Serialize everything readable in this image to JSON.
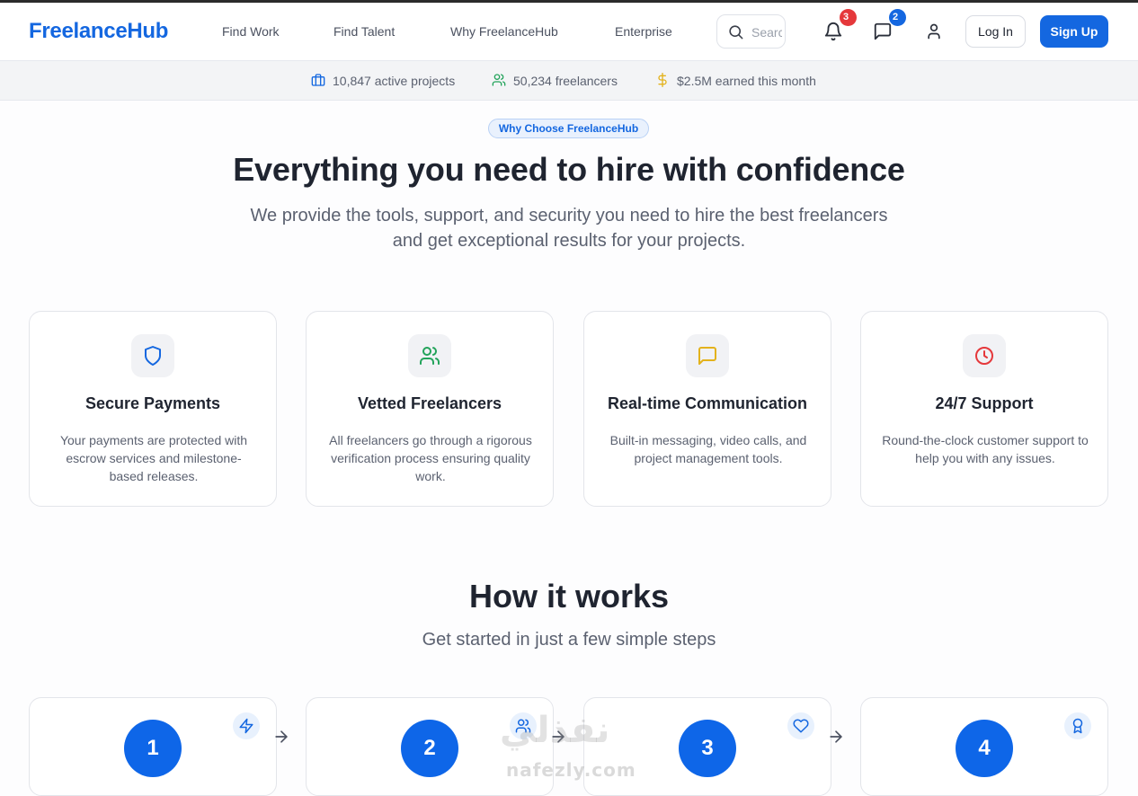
{
  "brand": {
    "name": "FreelanceHub",
    "primary_color": "#1467e0"
  },
  "nav": {
    "links": [
      "Find Work",
      "Find Talent",
      "Why FreelanceHub",
      "Enterprise"
    ],
    "search_placeholder": "Search",
    "notifications_count": "3",
    "messages_count": "2",
    "login_label": "Log In",
    "signup_label": "Sign Up",
    "icons": [
      "search-icon",
      "bell-icon",
      "message-icon",
      "user-icon"
    ]
  },
  "stats": [
    {
      "icon": "briefcase-icon",
      "text": "10,847 active projects"
    },
    {
      "icon": "users-icon",
      "text": "50,234 freelancers"
    },
    {
      "icon": "dollar-icon",
      "text": "$2.5M earned this month"
    }
  ],
  "hero": {
    "pill": "Why Choose FreelanceHub",
    "title": "Everything you need to hire with confidence",
    "subtitle_line1": "We provide the tools, support, and security you need to hire the best freelancers",
    "subtitle_line2": "and get exceptional results for your projects."
  },
  "features": [
    {
      "icon": "shield-icon",
      "title": "Secure Payments",
      "description": "Your payments are protected with escrow services and milestone-based releases."
    },
    {
      "icon": "users-icon",
      "title": "Vetted Freelancers",
      "description": "All freelancers go through a rigorous verification process ensuring quality work."
    },
    {
      "icon": "chat-icon",
      "title": "Real-time Communication",
      "description": "Built-in messaging, video calls, and project management tools."
    },
    {
      "icon": "clock-icon",
      "title": "24/7 Support",
      "description": "Round-the-clock customer support to help you with any issues."
    }
  ],
  "how_it_works": {
    "title": "How it works",
    "subtitle": "Get started in just a few simple steps",
    "steps": [
      {
        "number": "1",
        "icon": "zap-icon"
      },
      {
        "number": "2",
        "icon": "users-icon"
      },
      {
        "number": "3",
        "icon": "heart-icon"
      },
      {
        "number": "4",
        "icon": "award-icon"
      }
    ]
  },
  "watermark": {
    "arabic": "نفذلي",
    "latin": "nafezly.com"
  }
}
